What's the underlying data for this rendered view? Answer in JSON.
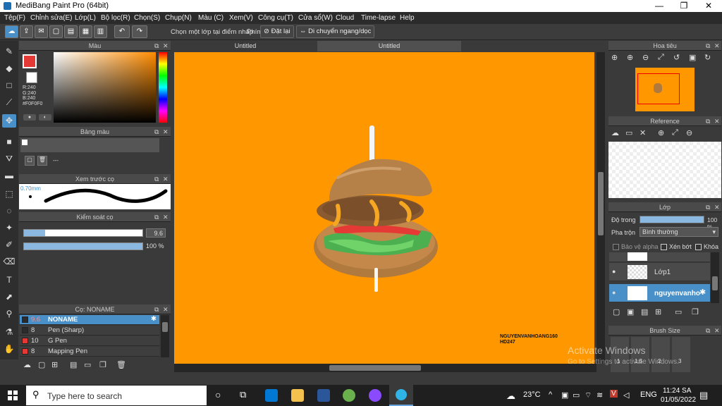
{
  "window": {
    "title": "MediBang Paint Pro (64bit)",
    "min": "—",
    "max": "❐",
    "close": "✕"
  },
  "menu": [
    "Tệp(F)",
    "Chỉnh sửa(E)",
    "Lớp(L)",
    "Bộ lọc(R)",
    "Chọn(S)",
    "Chụp(N)",
    "Màu (C)",
    "Xem(V)",
    "Công cụ(T)",
    "Cửa sổ(W)",
    "Cloud",
    "Time-lapse",
    "Help"
  ],
  "toolbar": {
    "undo": "↶",
    "redo": "↷",
    "select_layer_label": "Chọn một lớp tại điểm nhấp",
    "keys_label": "Phím",
    "reset_label": "Đặt lại",
    "move_label": "Di chuyển ngang/dọc"
  },
  "color_panel": {
    "title": "Màu",
    "r": "R:240",
    "g": "G:240",
    "b": "B:240",
    "hex": "#F0F0F0",
    "fg_color": "#ffffff",
    "accent": "#e53935"
  },
  "palette_panel": {
    "title": "Bảng màu",
    "dash": "---"
  },
  "brush_preview": {
    "title": "Xem trước cọ",
    "size": "0.70mm"
  },
  "brush_control": {
    "title": "Kiểm soát cọ",
    "size": "9.6",
    "opacity": "100 %",
    "size_fill": 0.18,
    "opacity_fill": 1.0
  },
  "brush_panel": {
    "title": "Cọ: NONAME",
    "items": [
      {
        "size": "9.6",
        "name": "NONAME",
        "color": "#2b2b2b",
        "selected": true
      },
      {
        "size": "8",
        "name": "Pen (Sharp)",
        "color": "#2b2b2b",
        "selected": false
      },
      {
        "size": "10",
        "name": "G Pen",
        "color": "#e53935",
        "selected": false
      },
      {
        "size": "8",
        "name": "Mapping Pen",
        "color": "#e53935",
        "selected": false
      }
    ]
  },
  "tabs": [
    "Untitled",
    "Untitled"
  ],
  "canvas": {
    "signature_line1": "NGUYENVANHOANG160",
    "signature_line2": "HD247",
    "bg": "#ff9800"
  },
  "navigator": {
    "title": "Hoa tiêu"
  },
  "reference": {
    "title": "Reference"
  },
  "layer_panel": {
    "title": "Lớp",
    "opacity_label": "Độ trong",
    "opacity_value": "100 %",
    "blend_label": "Pha trộn",
    "blend_value": "Bình thường",
    "protect_alpha": "Bảo vệ alpha",
    "clip": "Xén bớt",
    "lock": "Khóa",
    "layers": [
      {
        "name": "Lớp1",
        "selected": false
      },
      {
        "name": "nguyenvanho",
        "selected": true
      }
    ]
  },
  "brush_size_panel": {
    "title": "Brush Size",
    "values": [
      "1",
      "1.5",
      "2",
      "3"
    ]
  },
  "watermark": {
    "line1": "Activate Windows",
    "line2": "Go to Settings to activate Windows."
  },
  "taskbar": {
    "search_placeholder": "Type here to search",
    "temperature": "23°C",
    "language": "ENG",
    "time": "11:24 SA",
    "date": "01/05/2022"
  }
}
